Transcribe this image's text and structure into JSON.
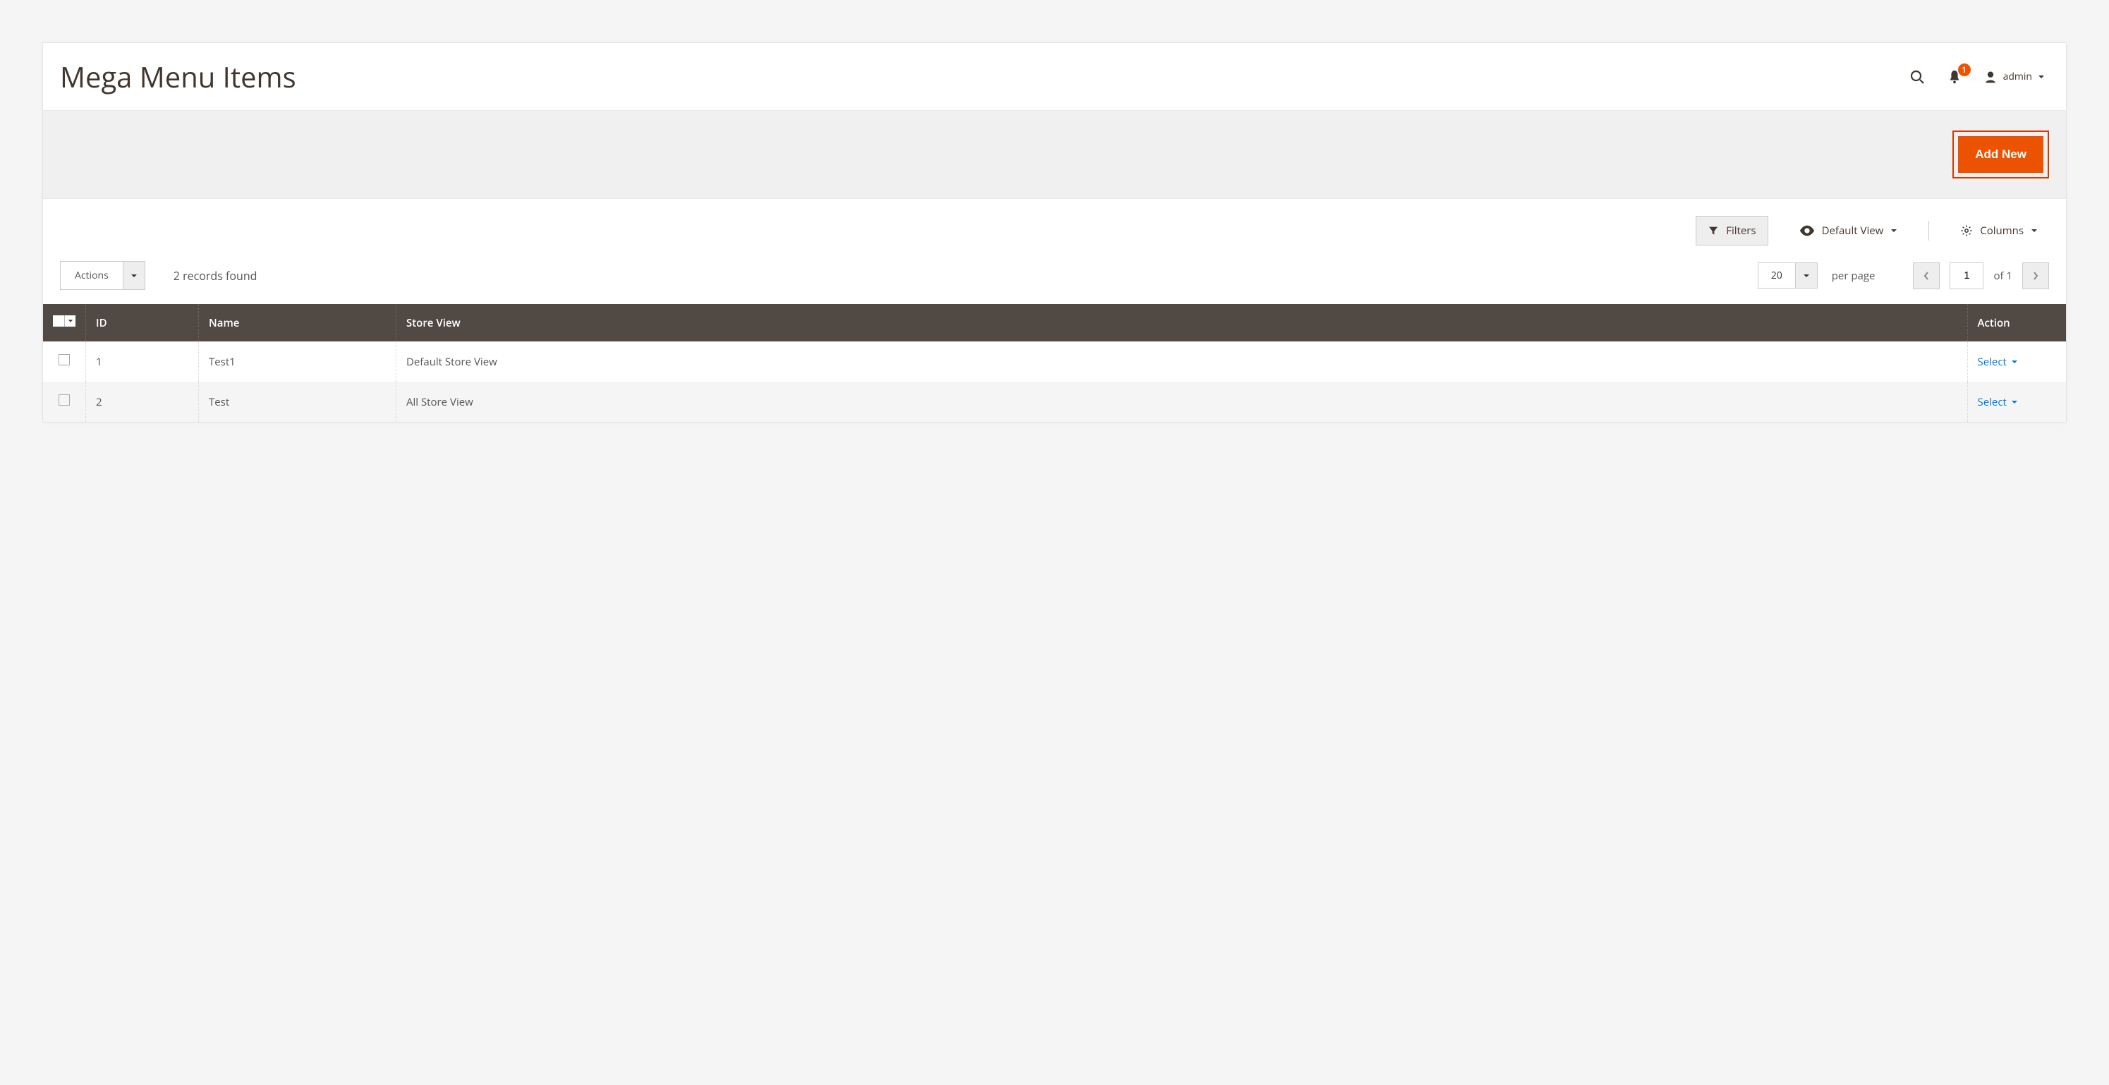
{
  "header": {
    "title": "Mega Menu Items",
    "notification_count": "1",
    "user_label": "admin"
  },
  "actions_bar": {
    "add_new_label": "Add New"
  },
  "controls": {
    "filters_label": "Filters",
    "default_view_label": "Default View",
    "columns_label": "Columns",
    "actions_label": "Actions",
    "records_found": "2 records found",
    "page_size": "20",
    "per_page_label": "per page",
    "current_page": "1",
    "of_pages": "of 1"
  },
  "table": {
    "columns": {
      "id": "ID",
      "name": "Name",
      "store_view": "Store View",
      "action": "Action"
    },
    "rows": [
      {
        "id": "1",
        "name": "Test1",
        "store_view": "Default Store View",
        "action": "Select"
      },
      {
        "id": "2",
        "name": "Test",
        "store_view": "All Store View",
        "action": "Select"
      }
    ]
  }
}
